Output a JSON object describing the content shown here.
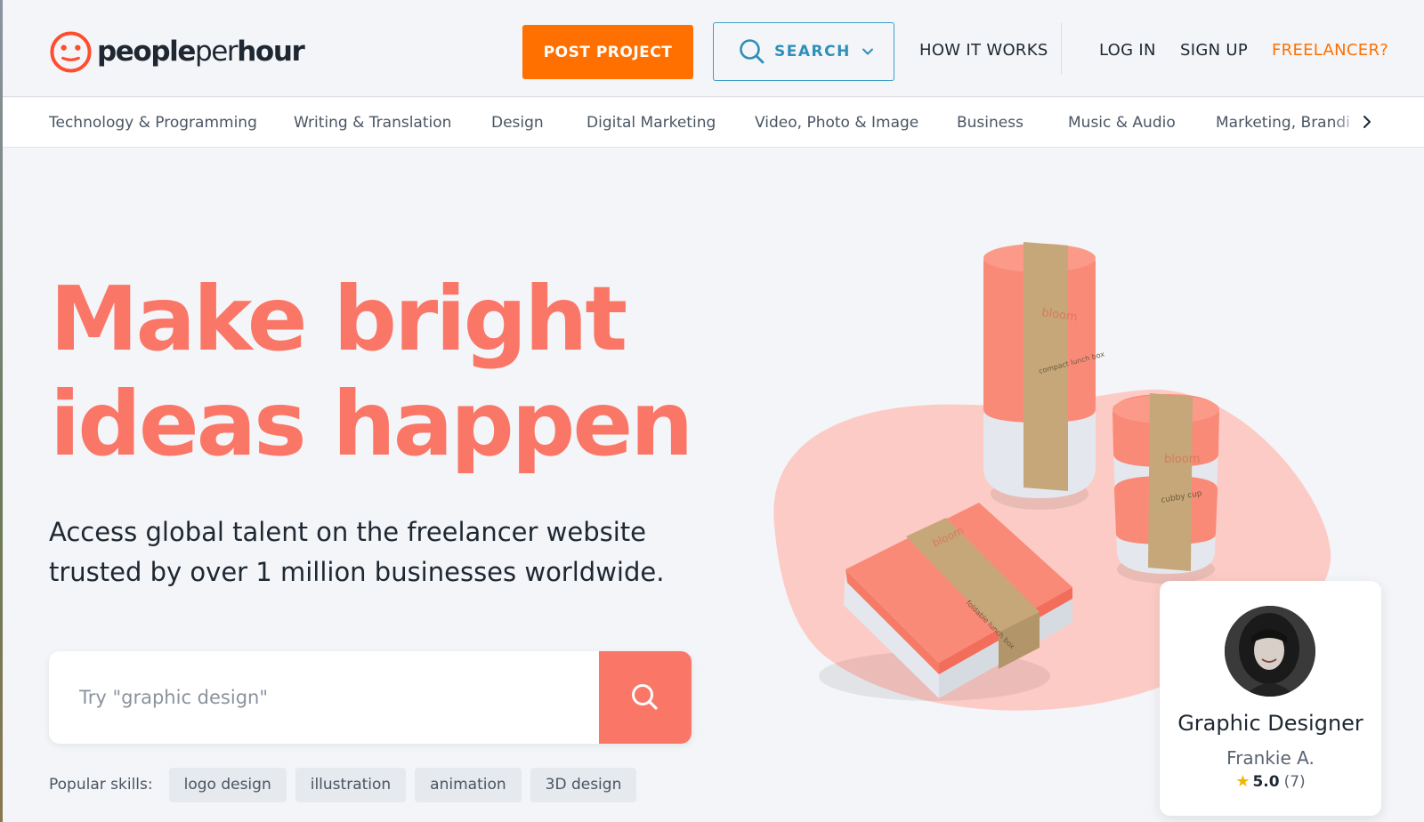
{
  "brand": {
    "name_part1": "people",
    "name_part2": "per",
    "name_part3": "hour",
    "color_primary": "#fa7768",
    "color_orange": "#ff7000",
    "color_teal": "#2e8fb8"
  },
  "header": {
    "post_project": "POST PROJECT",
    "search": "SEARCH",
    "how_it_works": "HOW IT WORKS",
    "log_in": "LOG IN",
    "sign_up": "SIGN UP",
    "freelancer": "FREELANCER?"
  },
  "categories": [
    "Technology & Programming",
    "Writing & Translation",
    "Design",
    "Digital Marketing",
    "Video, Photo & Image",
    "Business",
    "Music & Audio",
    "Marketing, Branding & Sales"
  ],
  "hero": {
    "title_line1": "Make bright",
    "title_line2": "ideas happen",
    "subtitle_line1": "Access global talent on the freelancer website",
    "subtitle_line2": "trusted by over 1 million businesses worldwide.",
    "search_placeholder": "Try \"graphic design\"",
    "popular_label": "Popular skills:",
    "popular_skills": [
      "logo design",
      "illustration",
      "animation",
      "3D design"
    ]
  },
  "illustration": {
    "product_brand": "bloom",
    "product_1": "compact lunch box",
    "product_2": "cubby cup",
    "product_3": "foldable lunch box"
  },
  "profile_card": {
    "role": "Graphic Designer",
    "name": "Frankie A.",
    "rating": "5.0",
    "reviews": "(7)"
  }
}
